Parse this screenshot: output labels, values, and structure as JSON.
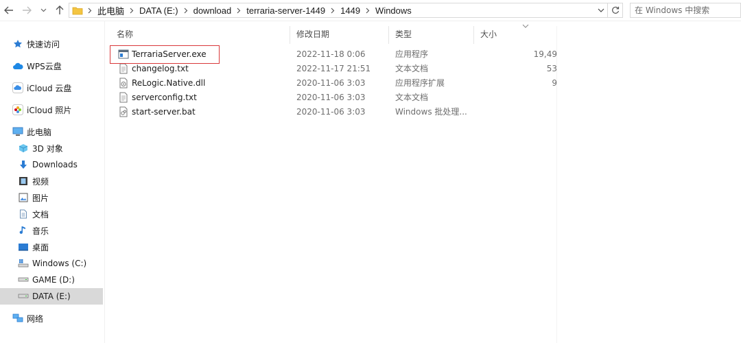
{
  "address": {
    "crumbs": [
      "此电脑",
      "DATA (E:)",
      "download",
      "terraria-server-1449",
      "1449",
      "Windows"
    ]
  },
  "search": {
    "placeholder": "在 Windows 中搜索"
  },
  "sidebar": {
    "items": [
      {
        "label": "快速访问",
        "icon": "star-icon"
      },
      {
        "label": "WPS云盘",
        "icon": "cloud-icon"
      },
      {
        "label": "iCloud 云盘",
        "icon": "icloud-icon"
      },
      {
        "label": "iCloud 照片",
        "icon": "photos-icon"
      },
      {
        "label": "此电脑",
        "icon": "pc-icon"
      },
      {
        "label": "3D 对象",
        "icon": "cube-icon"
      },
      {
        "label": "Downloads",
        "icon": "download-arrow-icon"
      },
      {
        "label": "视频",
        "icon": "video-icon"
      },
      {
        "label": "图片",
        "icon": "picture-icon"
      },
      {
        "label": "文档",
        "icon": "document-icon"
      },
      {
        "label": "音乐",
        "icon": "music-icon"
      },
      {
        "label": "桌面",
        "icon": "desktop-icon"
      },
      {
        "label": "Windows (C:)",
        "icon": "drive-icon"
      },
      {
        "label": "GAME (D:)",
        "icon": "drive-icon"
      },
      {
        "label": "DATA (E:)",
        "icon": "drive-icon"
      },
      {
        "label": "网络",
        "icon": "network-icon"
      }
    ]
  },
  "columns": {
    "name": "名称",
    "date": "修改日期",
    "type": "类型",
    "size": "大小"
  },
  "files": [
    {
      "name": "TerrariaServer.exe",
      "date": "2022-11-18 0:06",
      "type": "应用程序",
      "size": "19,49",
      "icon": "exe-icon"
    },
    {
      "name": "changelog.txt",
      "date": "2022-11-17 21:51",
      "type": "文本文档",
      "size": "53",
      "icon": "text-file-icon"
    },
    {
      "name": "ReLogic.Native.dll",
      "date": "2020-11-06 3:03",
      "type": "应用程序扩展",
      "size": "9",
      "icon": "dll-icon"
    },
    {
      "name": "serverconfig.txt",
      "date": "2020-11-06 3:03",
      "type": "文本文档",
      "size": "",
      "icon": "text-file-icon"
    },
    {
      "name": "start-server.bat",
      "date": "2020-11-06 3:03",
      "type": "Windows 批处理...",
      "size": "",
      "icon": "bat-icon"
    }
  ],
  "colors": {
    "highlight_border": "#d9383a",
    "selected_bg": "#d9d9d9",
    "folder": "#f4c542"
  }
}
